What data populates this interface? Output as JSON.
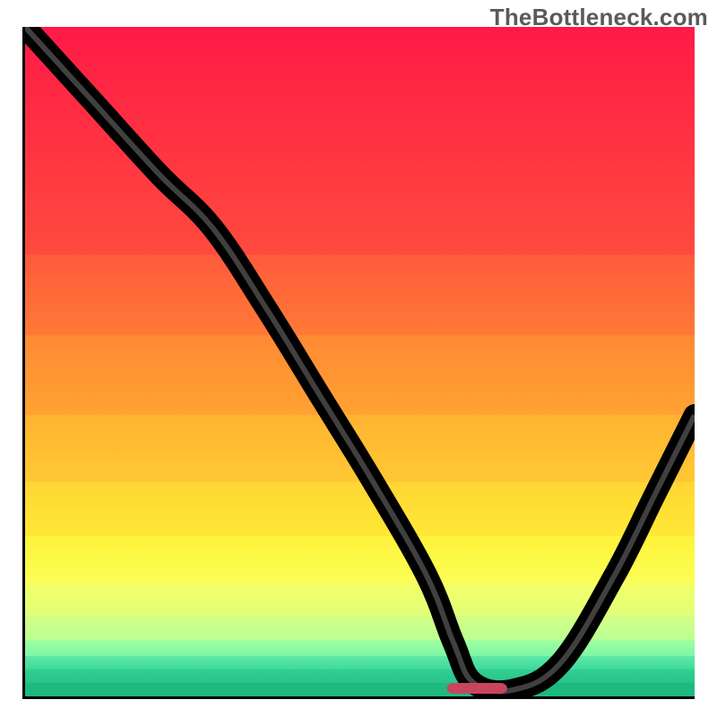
{
  "watermark": "TheBottleneck.com",
  "chart_data": {
    "type": "line",
    "title": "",
    "xlabel": "",
    "ylabel": "",
    "xlim": [
      0,
      100
    ],
    "ylim": [
      0,
      100
    ],
    "x": [
      0,
      10,
      20,
      28,
      36,
      44,
      52,
      60,
      64,
      67,
      73,
      80,
      88,
      94,
      100
    ],
    "values": [
      100,
      89,
      78,
      70,
      58,
      45,
      32,
      18,
      8,
      2,
      1,
      5,
      18,
      30,
      42
    ],
    "marker": {
      "x_start": 63,
      "x_end": 72,
      "y": 0
    },
    "gradient_stops": [
      {
        "pos": 0.0,
        "color": "#ff1a46"
      },
      {
        "pos": 0.34,
        "color": "#ff5a3c"
      },
      {
        "pos": 0.46,
        "color": "#ff8934"
      },
      {
        "pos": 0.58,
        "color": "#ffb232"
      },
      {
        "pos": 0.68,
        "color": "#ffd634"
      },
      {
        "pos": 0.76,
        "color": "#fff23a"
      },
      {
        "pos": 0.83,
        "color": "#f4ff66"
      },
      {
        "pos": 0.88,
        "color": "#d4ff86"
      },
      {
        "pos": 0.915,
        "color": "#a2ff9e"
      },
      {
        "pos": 0.94,
        "color": "#5ee9a7"
      },
      {
        "pos": 0.96,
        "color": "#32cf92"
      },
      {
        "pos": 0.98,
        "color": "#1eb97e"
      }
    ]
  }
}
